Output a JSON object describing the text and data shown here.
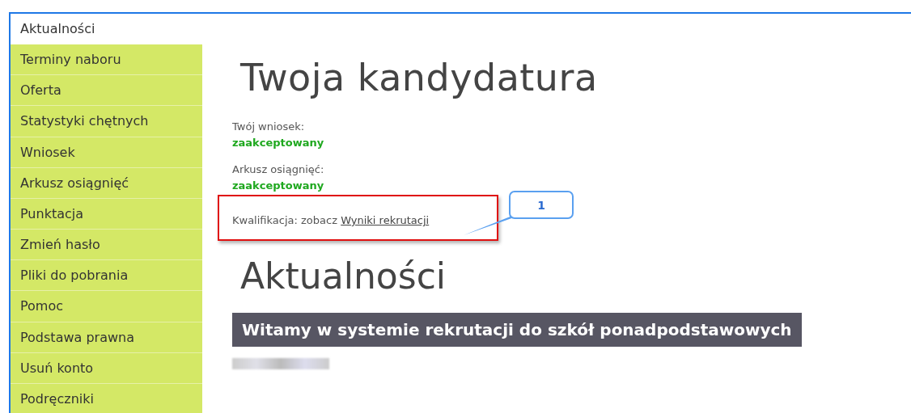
{
  "sidebar": {
    "items": [
      {
        "label": "Aktualności",
        "selected": true
      },
      {
        "label": "Terminy naboru",
        "selected": false
      },
      {
        "label": "Oferta",
        "selected": false
      },
      {
        "label": "Statystyki chętnych",
        "selected": false
      },
      {
        "label": "Wniosek",
        "selected": false
      },
      {
        "label": "Arkusz osiągnięć",
        "selected": false
      },
      {
        "label": "Punktacja",
        "selected": false
      },
      {
        "label": "Zmień hasło",
        "selected": false
      },
      {
        "label": "Pliki do pobrania",
        "selected": false
      },
      {
        "label": "Pomoc",
        "selected": false
      },
      {
        "label": "Podstawa prawna",
        "selected": false
      },
      {
        "label": "Usuń konto",
        "selected": false
      },
      {
        "label": "Podręczniki",
        "selected": false
      }
    ]
  },
  "candidacy": {
    "title": "Twoja kandydatura",
    "statuses": [
      {
        "label": "Twój wniosek:",
        "value": "zaakceptowany"
      },
      {
        "label": "Arkusz osiągnięć:",
        "value": "zaakceptowany"
      }
    ],
    "qualification": {
      "text": "Kwalifikacja: zobacz",
      "link": "Wyniki rekrutacji"
    },
    "callout": "1"
  },
  "news": {
    "title": "Aktualności",
    "headline": "Witamy w systemie rekrutacji do szkół ponadpodstawowych"
  }
}
